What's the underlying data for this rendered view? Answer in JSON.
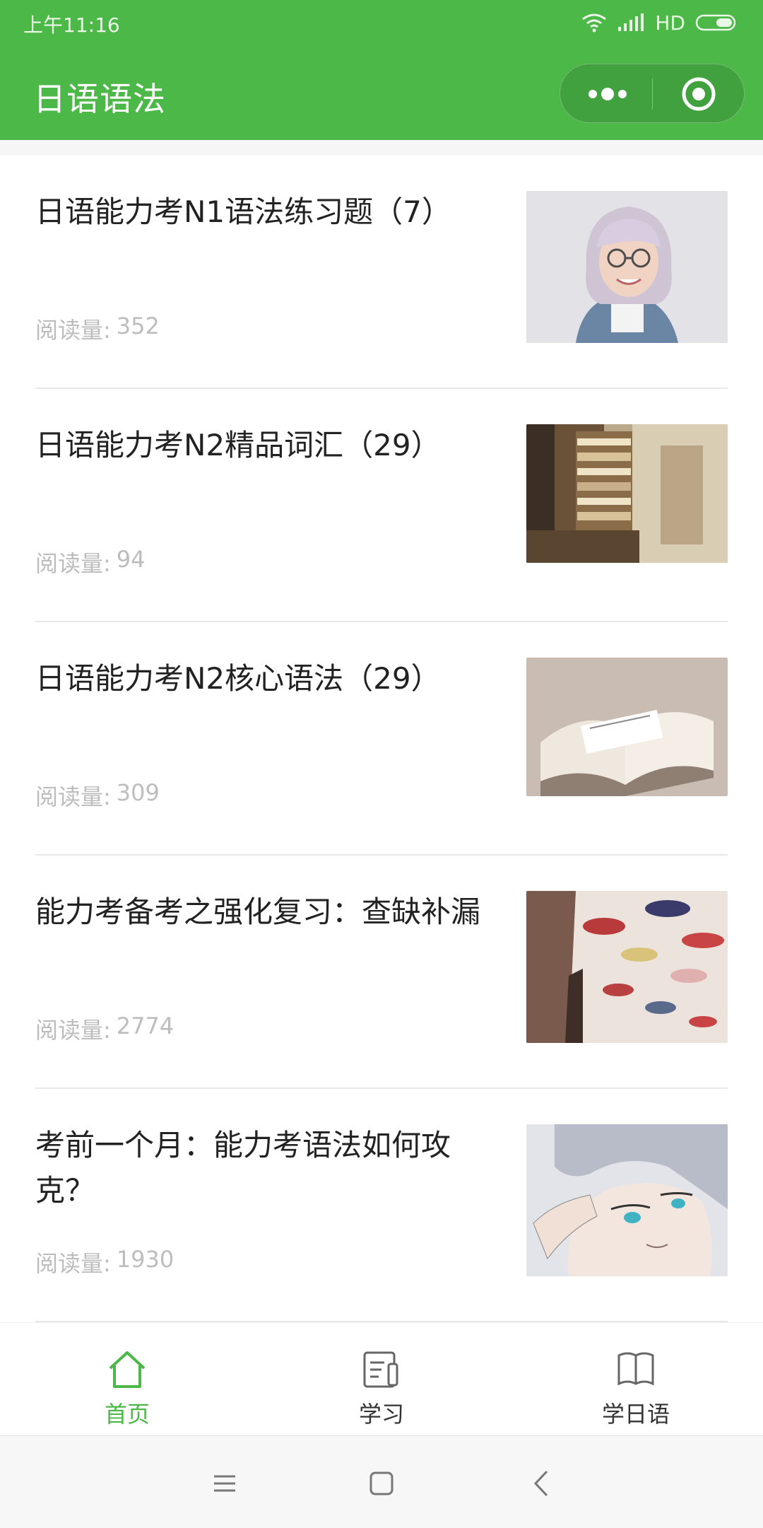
{
  "status_bar": {
    "time": "上午11:16",
    "network": "HD"
  },
  "header": {
    "title": "日语语法",
    "accent": "#4CB848"
  },
  "views_label": "阅读量:",
  "articles": [
    {
      "title": "日语能力考N1语法练习题（7）",
      "views": "352",
      "thumb": "girl-with-glasses"
    },
    {
      "title": "日语能力考N2精品词汇（29）",
      "views": "94",
      "thumb": "bookshelf"
    },
    {
      "title": "日语能力考N2核心语法（29）",
      "views": "309",
      "thumb": "open-book"
    },
    {
      "title": "能力考备考之强化复习：查缺补漏",
      "views": "2774",
      "thumb": "umbrellas-street"
    },
    {
      "title": "考前一个月：能力考语法如何攻克？",
      "views": "1930",
      "thumb": "anime-character"
    }
  ],
  "tabs": [
    {
      "label": "首页",
      "icon": "home-icon",
      "active": true
    },
    {
      "label": "学习",
      "icon": "study-icon",
      "active": false
    },
    {
      "label": "学日语",
      "icon": "book-icon",
      "active": false
    }
  ]
}
